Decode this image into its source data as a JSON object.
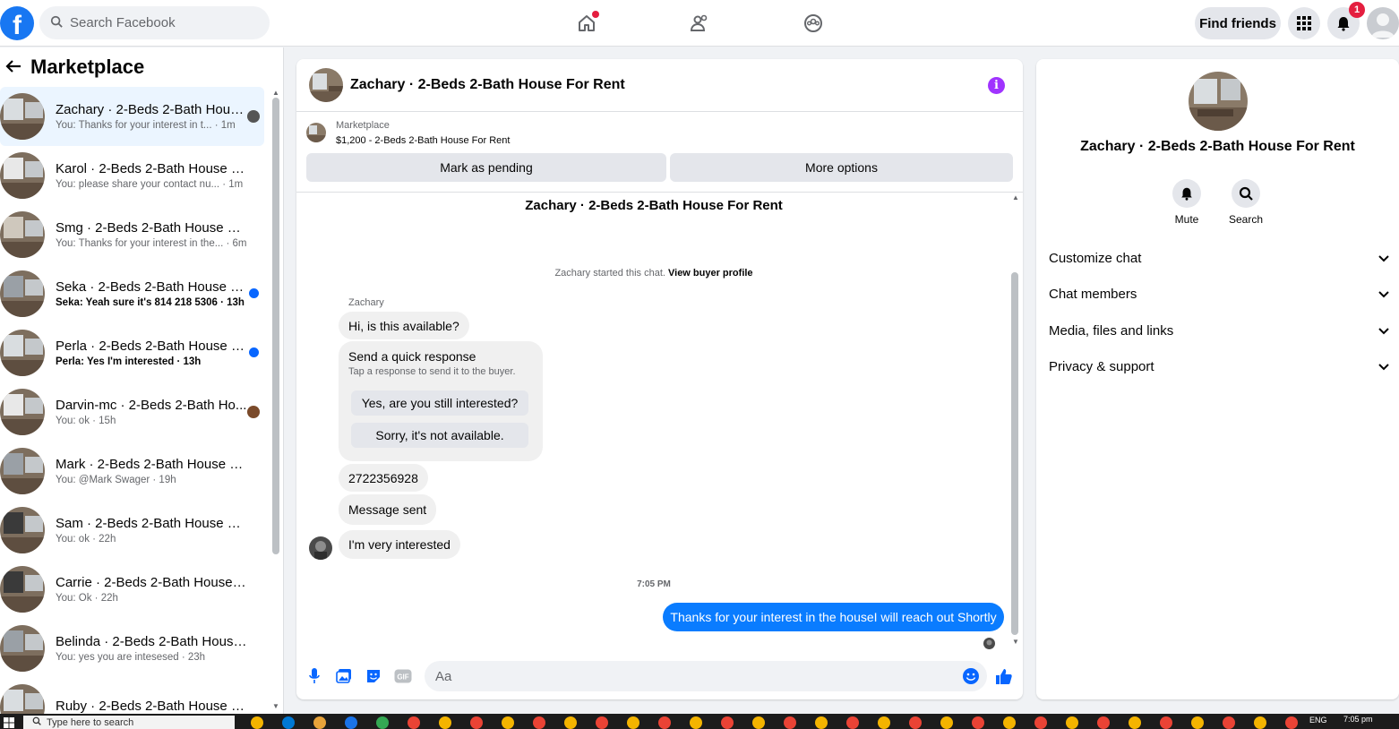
{
  "topbar": {
    "search_placeholder": "Search Facebook",
    "find_friends": "Find friends",
    "notification_count": "1"
  },
  "left": {
    "title": "Marketplace",
    "threads": [
      {
        "name": "Zachary · 2-Beds 2-Bath Hous...",
        "snippet": "You: Thanks for your interest in t... · 1m",
        "unread": false
      },
      {
        "name": "Karol · 2-Beds 2-Bath House For ...",
        "snippet": "You: please share your contact nu... · 1m",
        "unread": false
      },
      {
        "name": "Smg · 2-Beds 2-Bath House For ...",
        "snippet": "You: Thanks for your interest in the... · 6m",
        "unread": false
      },
      {
        "name": "Seka · 2-Beds 2-Bath House Fo...",
        "snippet": "Seka: Yeah sure it's 814 218 5306 · 13h",
        "unread": true
      },
      {
        "name": "Perla · 2-Beds 2-Bath House Fo...",
        "snippet": "Perla: Yes I'm interested · 13h",
        "unread": true
      },
      {
        "name": "Darvin-mc · 2-Beds 2-Bath Ho...",
        "snippet": "You: ok · 15h",
        "unread": false
      },
      {
        "name": "Mark · 2-Beds 2-Bath House For ...",
        "snippet": "You: @Mark Swager · 19h",
        "unread": false
      },
      {
        "name": "Sam · 2-Beds 2-Bath House For ...",
        "snippet": "You: ok · 22h",
        "unread": false
      },
      {
        "name": "Carrie · 2-Beds 2-Bath House For...",
        "snippet": "You: Ok · 22h",
        "unread": false
      },
      {
        "name": "Belinda · 2-Beds 2-Bath House F...",
        "snippet": "You: yes you are intesesed · 23h",
        "unread": false
      },
      {
        "name": "Ruby · 2-Beds 2-Bath House For ...",
        "snippet": "",
        "unread": false
      }
    ]
  },
  "chat": {
    "title": "Zachary · 2-Beds 2-Bath House For Rent",
    "listing_category": "Marketplace",
    "listing_price": "$1,200 - 2-Beds 2-Bath House For Rent",
    "mark_pending": "Mark as pending",
    "more_options": "More options",
    "conversation_title": "Zachary · 2-Beds 2-Bath House For Rent",
    "started_text": "Zachary started this chat.",
    "view_profile": "View buyer profile",
    "sender": "Zachary",
    "messages": {
      "m1": "Hi, is this available?",
      "quick_title": "Send a quick response",
      "quick_sub": "Tap a response to send it to the buyer.",
      "quick_1": "Yes, are you still interested?",
      "quick_2": "Sorry, it's not available.",
      "m2": "2722356928",
      "m3": "Message sent",
      "m4": "I'm very interested",
      "time": "7:05 PM",
      "out": "Thanks for your interest in the houseI will reach out Shortly"
    },
    "composer_placeholder": "Aa"
  },
  "right": {
    "name": "Zachary · 2-Beds 2-Bath House For Rent",
    "mute": "Mute",
    "search": "Search",
    "sections": [
      "Customize chat",
      "Chat members",
      "Media, files and links",
      "Privacy & support"
    ]
  },
  "taskbar": {
    "search_placeholder": "Type here to search",
    "lang": "ENG",
    "time": "7:05 pm"
  },
  "colors": {
    "brand": "#1877f2",
    "outgoing_bubble": "#0a7cff",
    "unread_dot": "#0866ff",
    "info": "#a033ff"
  }
}
